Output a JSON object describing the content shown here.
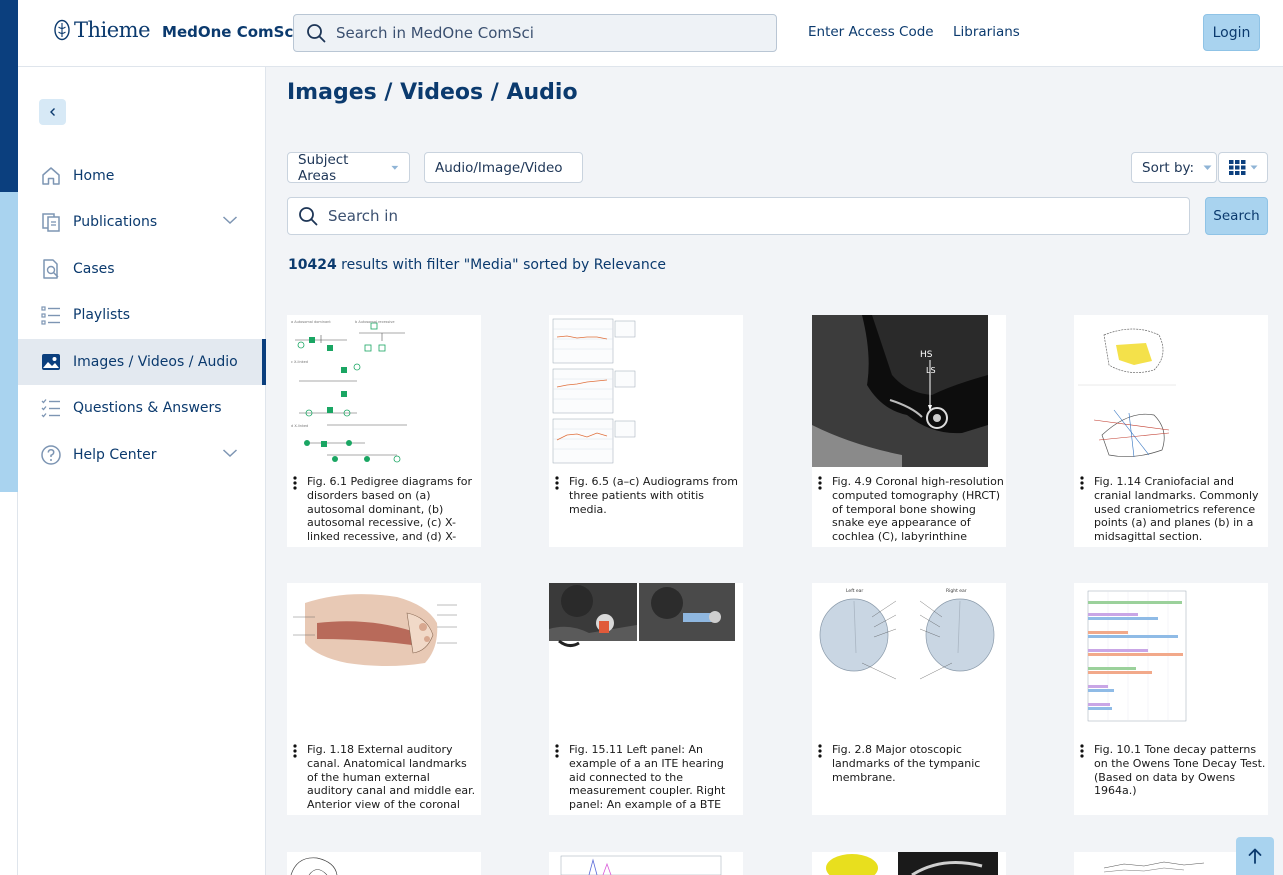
{
  "header": {
    "logo_brand": "Thieme",
    "logo_product": "MedOne ComSci",
    "search_placeholder": "Search in MedOne ComSci",
    "links": [
      "Enter Access Code",
      "Librarians"
    ],
    "login_label": "Login"
  },
  "sidebar": {
    "items": [
      {
        "label": "Home",
        "icon": "home-icon",
        "active": false,
        "expandable": false
      },
      {
        "label": "Publications",
        "icon": "publications-icon",
        "active": false,
        "expandable": true
      },
      {
        "label": "Cases",
        "icon": "cases-icon",
        "active": false,
        "expandable": false
      },
      {
        "label": "Playlists",
        "icon": "playlist-icon",
        "active": false,
        "expandable": false
      },
      {
        "label": "Images / Videos / Audio",
        "icon": "image-icon",
        "active": true,
        "expandable": false
      },
      {
        "label": "Questions & Answers",
        "icon": "checklist-icon",
        "active": false,
        "expandable": false
      },
      {
        "label": "Help Center",
        "icon": "help-icon",
        "active": false,
        "expandable": true
      }
    ]
  },
  "main": {
    "title": "Images / Videos / Audio",
    "filters": [
      "Subject Areas",
      "Audio/Image/Video"
    ],
    "sort_label": "Sort by:",
    "search_placeholder": "Search in",
    "search_button": "Search",
    "results": {
      "count": "10424",
      "text": " results with filter \"Media\" sorted by Relevance"
    },
    "cards": [
      {
        "caption": "Fig. 6.1 Pedigree diagrams for disorders based on (a) autosomal dominant, (b) autosomal recessive, (c) X-linked recessive, and (d) X-linked dominant…",
        "thumb": "pedigree"
      },
      {
        "caption": "Fig. 6.5 (a–c) Audiograms from three patients with otitis media.",
        "thumb": "audiogram"
      },
      {
        "caption": "Fig. 4.9 Coronal high-resolution computed tomography (HRCT) of temporal bone showing snake eye appearance of cochlea (C), labyrinthine segment (LS), and…",
        "thumb": "ct",
        "thumb_labels": [
          "HS",
          "LS"
        ]
      },
      {
        "caption": "Fig. 1.14 Craniofacial and cranial landmarks. Commonly used craniometrics reference points (a) and planes (b) in a midsagittal section.",
        "thumb": "cranial"
      },
      {
        "caption": "Fig. 1.18 External auditory canal. Anatomical landmarks of the human external auditory canal and middle ear. Anterior view of the coronal section through th…",
        "thumb": "ear"
      },
      {
        "caption": "Fig. 15.11 Left panel: An example of a an ITE hearing aid connected to the measurement coupler. Right panel: An example of a BTE hearing aid connected to the…",
        "thumb": "hearing-aid"
      },
      {
        "caption": "Fig. 2.8 Major otoscopic landmarks of the tympanic membrane.",
        "thumb": "tympanic",
        "thumb_labels": [
          "Left ear",
          "Right ear"
        ]
      },
      {
        "caption": "Fig. 10.1 Tone decay patterns on the Owens Tone Decay Test. (Based on data by Owens 1964a.)",
        "thumb": "bars"
      }
    ]
  },
  "colors": {
    "brand_dark": "#0b3f7e",
    "accent_light": "#a9d3ef",
    "text": "#0b3a6e"
  }
}
